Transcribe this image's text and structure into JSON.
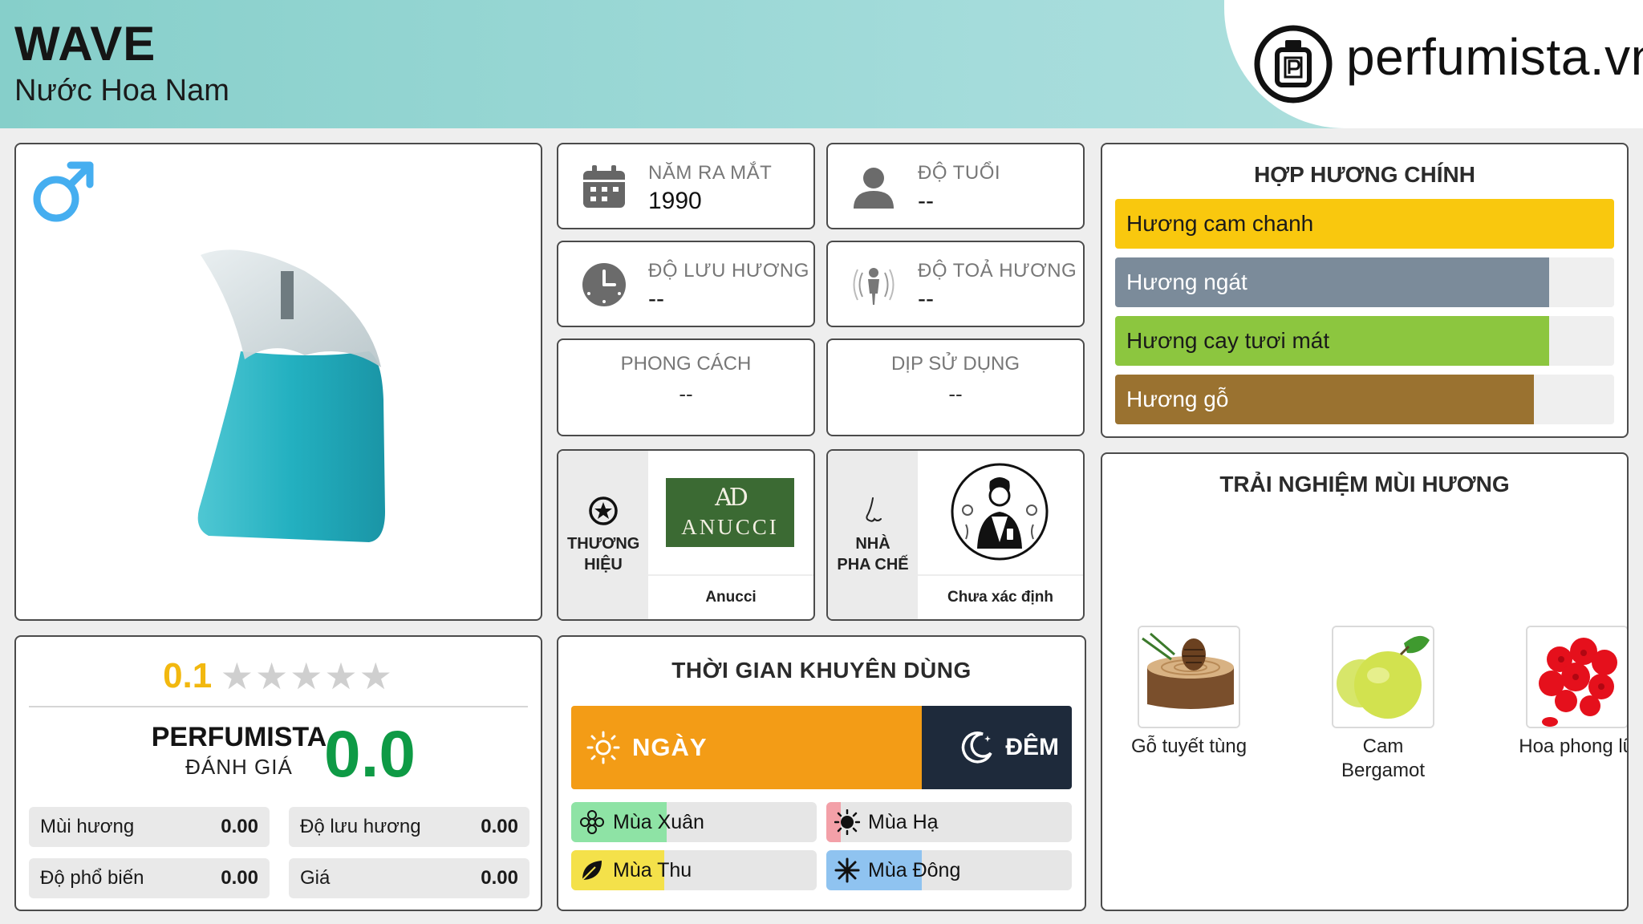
{
  "header": {
    "title": "WAVE",
    "subtitle": "Nước Hoa Nam",
    "logo_text": "perfumista.vn",
    "background_color": "#a4dcdb"
  },
  "product": {
    "gender_icon": "male-icon",
    "bottle_colors": {
      "liquid": "#28b3c2",
      "cap": "#d9e0e3"
    }
  },
  "rating": {
    "score": "0.1",
    "stars_total": 5,
    "stars_filled": 0,
    "perfumista_label": "PERFUMISTA",
    "perfumista_sub": "ĐÁNH GIÁ",
    "perfumista_score": "0.0",
    "metrics": [
      {
        "label": "Mùi hương",
        "value": "0.00"
      },
      {
        "label": "Độ lưu hương",
        "value": "0.00"
      },
      {
        "label": "Độ phổ biến",
        "value": "0.00"
      },
      {
        "label": "Giá",
        "value": "0.00"
      }
    ]
  },
  "info": {
    "release": {
      "label": "NĂM RA MẮT",
      "value": "1990",
      "icon": "calendar-icon"
    },
    "age": {
      "label": "ĐỘ TUỔI",
      "value": "--",
      "icon": "person-icon"
    },
    "longevity": {
      "label": "ĐỘ LƯU HƯƠNG",
      "value": "--",
      "icon": "clock-icon"
    },
    "sillage": {
      "label": "ĐỘ TOẢ HƯƠNG",
      "value": "--",
      "icon": "sillage-icon"
    },
    "style": {
      "label": "PHONG CÁCH",
      "value": "--"
    },
    "occasion": {
      "label": "DỊP SỬ DỤNG",
      "value": "--"
    }
  },
  "brand": {
    "label": "THƯƠNG HIỆU",
    "name": "Anucci",
    "logo_monogram": "AD",
    "logo_word": "ANUCCI",
    "logo_color": "#3b6a33"
  },
  "perfumer": {
    "label": "NHÀ PHA CHẾ",
    "name": "Chưa xác định"
  },
  "time": {
    "title": "THỜI GIAN KHUYÊN DÙNG",
    "day_label": "NGÀY",
    "night_label": "ĐÊM",
    "day_fraction": 0.7,
    "day_color": "#f39c16",
    "night_color": "#1e2a3b",
    "seasons": [
      {
        "label": "Mùa Xuân",
        "icon": "flower-icon",
        "fill": 0.39,
        "color": "#8ee3a5"
      },
      {
        "label": "Mùa Hạ",
        "icon": "sun-icon",
        "fill": 0.06,
        "color": "#f3a0a8"
      },
      {
        "label": "Mùa Thu",
        "icon": "leaf-icon",
        "fill": 0.38,
        "color": "#f4e14a"
      },
      {
        "label": "Mùa Đông",
        "icon": "snowflake-icon",
        "fill": 0.39,
        "color": "#8fc3f0"
      }
    ]
  },
  "accords": {
    "title": "HỢP HƯƠNG CHÍNH",
    "items": [
      {
        "label": "Hương cam chanh",
        "fill": 1.0,
        "color": "#f9c80e",
        "text_color": "#1a1a1a"
      },
      {
        "label": "Hương ngát",
        "fill": 0.87,
        "color": "#7b8b9a",
        "text_color": "#ffffff"
      },
      {
        "label": "Hương cay tươi mát",
        "fill": 0.87,
        "color": "#8cc63f",
        "text_color": "#1a1a1a"
      },
      {
        "label": "Hương gỗ",
        "fill": 0.84,
        "color": "#9a7230",
        "text_color": "#ffffff"
      }
    ]
  },
  "notes": {
    "title": "TRẢI NGHIỆM MÙI HƯƠNG",
    "items": [
      {
        "label": "Gỗ tuyết tùng",
        "icon": "cedar-wood-icon"
      },
      {
        "label": "Cam Bergamot",
        "icon": "bergamot-icon"
      },
      {
        "label": "Hoa phong lữ",
        "icon": "geranium-icon"
      }
    ]
  }
}
